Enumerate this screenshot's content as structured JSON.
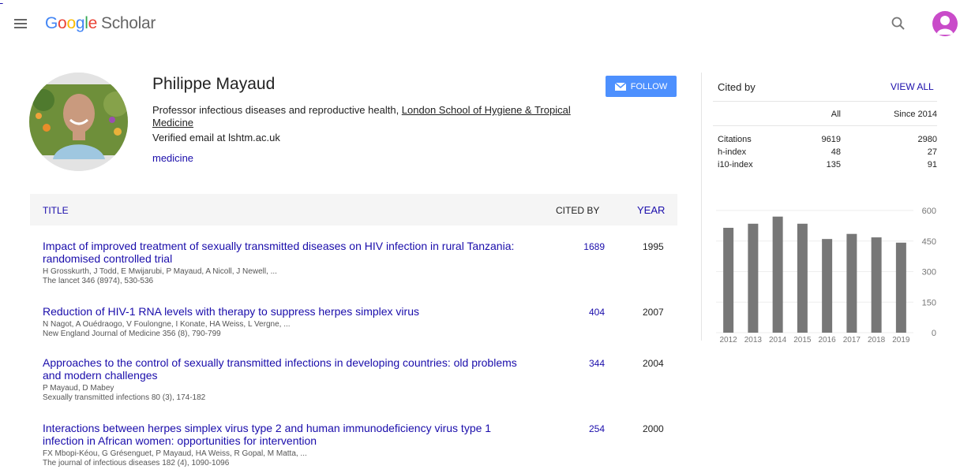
{
  "header": {
    "logo_text": "Google",
    "logo_product": "Scholar"
  },
  "profile": {
    "name": "Philippe Mayaud",
    "affiliation_prefix": "Professor infectious diseases and reproductive health, ",
    "affiliation_link": "London School of Hygiene & Tropical Medicine",
    "email": "Verified email at lshtm.ac.uk",
    "interest": "medicine",
    "follow_label": "FOLLOW"
  },
  "table": {
    "col_title": "TITLE",
    "col_cited": "CITED BY",
    "col_year": "YEAR",
    "rows": [
      {
        "title": "Impact of improved treatment of sexually transmitted diseases on HIV infection in rural Tanzania: randomised controlled trial",
        "authors": "H Grosskurth, J Todd, E Mwijarubi, P Mayaud, A Nicoll, J Newell, ...",
        "venue": "The lancet 346 (8974), 530-536",
        "cited": "1689",
        "year": "1995"
      },
      {
        "title": "Reduction of HIV-1 RNA levels with therapy to suppress herpes simplex virus",
        "authors": "N Nagot, A Ouédraogo, V Foulongne, I Konate, HA Weiss, L Vergne, ...",
        "venue": "New England Journal of Medicine 356 (8), 790-799",
        "cited": "404",
        "year": "2007"
      },
      {
        "title": "Approaches to the control of sexually transmitted infections in developing countries: old problems and modern challenges",
        "authors": "P Mayaud, D Mabey",
        "venue": "Sexually transmitted infections 80 (3), 174-182",
        "cited": "344",
        "year": "2004"
      },
      {
        "title": "Interactions between herpes simplex virus type 2 and human immunodeficiency virus type 1 infection in African women: opportunities for intervention",
        "authors": "FX Mbopi-Kéou, G Grésenguet, P Mayaud, HA Weiss, R Gopal, M Matta, ...",
        "venue": "The journal of infectious diseases 182 (4), 1090-1096",
        "cited": "254",
        "year": "2000"
      }
    ]
  },
  "cited_by": {
    "title": "Cited by",
    "view_all": "VIEW ALL",
    "col_all": "All",
    "col_since": "Since 2014",
    "rows": [
      {
        "label": "Citations",
        "all": "9619",
        "since": "2980"
      },
      {
        "label": "h-index",
        "all": "48",
        "since": "27"
      },
      {
        "label": "i10-index",
        "all": "135",
        "since": "91"
      }
    ]
  },
  "chart_data": {
    "type": "bar",
    "categories": [
      "2012",
      "2013",
      "2014",
      "2015",
      "2016",
      "2017",
      "2018",
      "2019"
    ],
    "values": [
      515,
      535,
      570,
      535,
      460,
      485,
      468,
      442
    ],
    "ylim": [
      0,
      600
    ],
    "yticks": [
      "0",
      "150",
      "300",
      "450",
      "600"
    ],
    "bar_color": "#777777"
  },
  "colors": {
    "link": "#1a0dab",
    "follow_button": "#4d90fe",
    "avatar": "#c94bc9"
  }
}
